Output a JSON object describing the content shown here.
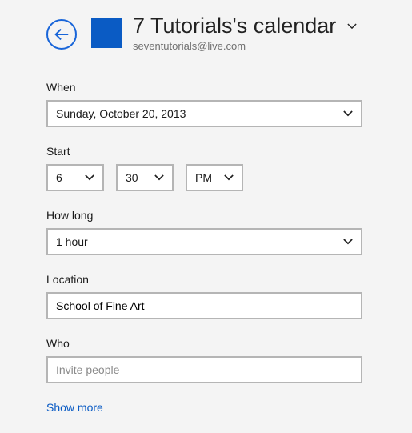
{
  "header": {
    "title": "7 Tutorials's calendar",
    "account": "seventutorials@live.com",
    "accent_color": "#0a5bc4"
  },
  "fields": {
    "when": {
      "label": "When",
      "value": "Sunday, October 20, 2013"
    },
    "start": {
      "label": "Start",
      "hour": "6",
      "minute": "30",
      "period": "PM"
    },
    "how_long": {
      "label": "How long",
      "value": "1 hour"
    },
    "location": {
      "label": "Location",
      "value": "School of Fine Art"
    },
    "who": {
      "label": "Who",
      "placeholder": "Invite people"
    }
  },
  "actions": {
    "show_more": "Show more"
  }
}
